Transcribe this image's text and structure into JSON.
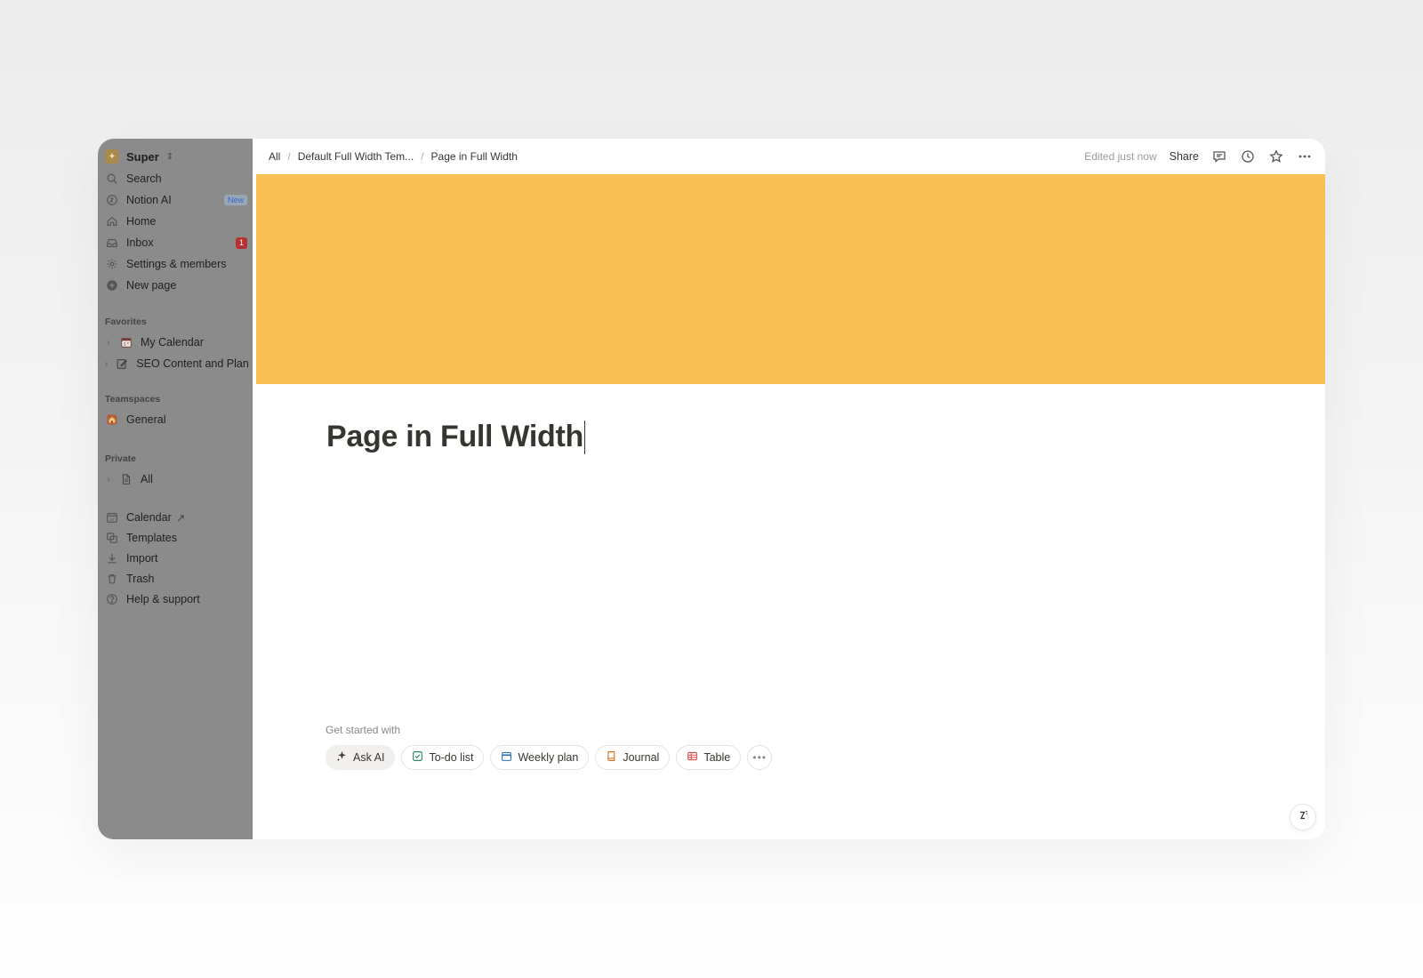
{
  "workspace": {
    "name": "Super",
    "icon": "workspace-icon"
  },
  "sidebar": {
    "top_items": [
      {
        "label": "Search",
        "icon": "search-icon"
      },
      {
        "label": "Notion AI",
        "icon": "notion-ai-icon",
        "badge": "New"
      },
      {
        "label": "Home",
        "icon": "home-icon"
      },
      {
        "label": "Inbox",
        "icon": "inbox-icon",
        "count": "1"
      },
      {
        "label": "Settings & members",
        "icon": "gear-icon"
      },
      {
        "label": "New page",
        "icon": "plus-circle-icon"
      }
    ],
    "favorites_heading": "Favorites",
    "favorites": [
      {
        "label": "My Calendar",
        "icon": "calendar-page-icon"
      },
      {
        "label": "SEO Content and Plan",
        "icon": "edit-page-icon"
      }
    ],
    "teamspaces_heading": "Teamspaces",
    "teamspaces": [
      {
        "label": "General",
        "icon": "house-emoji-icon"
      }
    ],
    "private_heading": "Private",
    "private": [
      {
        "label": "All",
        "icon": "document-icon"
      }
    ],
    "bottom_items": [
      {
        "label": "Calendar",
        "icon": "calendar-icon",
        "external": "↗"
      },
      {
        "label": "Templates",
        "icon": "templates-icon"
      },
      {
        "label": "Import",
        "icon": "download-icon"
      },
      {
        "label": "Trash",
        "icon": "trash-icon"
      },
      {
        "label": "Help & support",
        "icon": "help-circle-icon"
      }
    ]
  },
  "topbar": {
    "breadcrumbs": [
      "All",
      "Default Full Width Tem...",
      "Page in Full Width"
    ],
    "separator": "/",
    "edited": "Edited just now",
    "share": "Share"
  },
  "page": {
    "cover_color": "#f8c054",
    "title": "Page in Full Width"
  },
  "get_started": {
    "label": "Get started with",
    "chips": [
      {
        "label": "Ask AI",
        "icon": "sparkle-icon"
      },
      {
        "label": "To-do list",
        "icon": "checkbox-icon"
      },
      {
        "label": "Weekly plan",
        "icon": "calendar-icon"
      },
      {
        "label": "Journal",
        "icon": "book-icon"
      },
      {
        "label": "Table",
        "icon": "table-icon"
      }
    ],
    "more": "•••"
  }
}
